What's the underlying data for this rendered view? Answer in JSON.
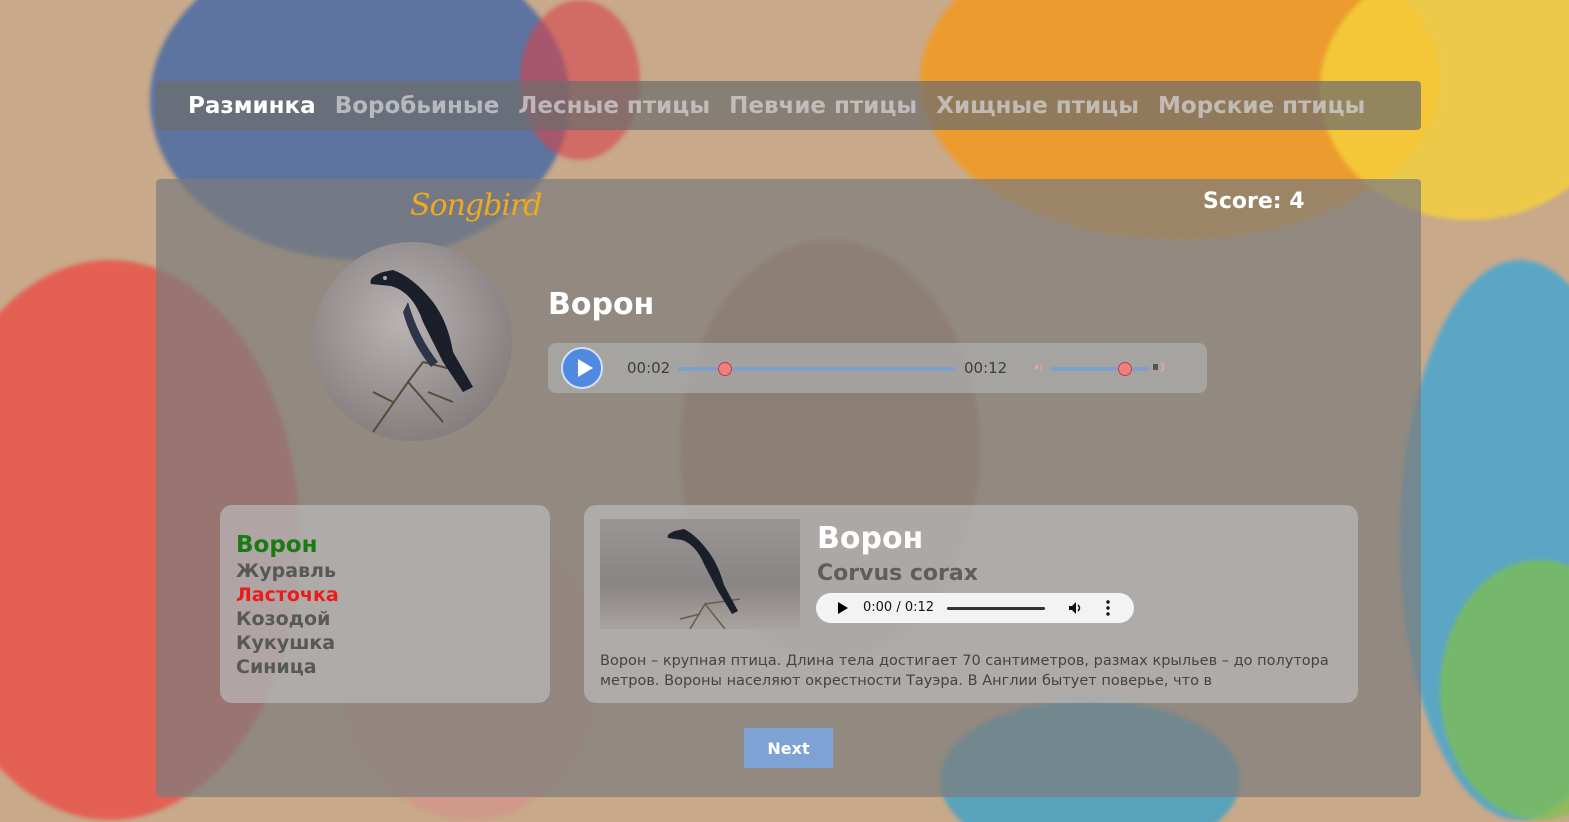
{
  "nav": {
    "items": [
      {
        "label": "Разминка",
        "active": true
      },
      {
        "label": "Воробьиные",
        "active": false
      },
      {
        "label": "Лесные птицы",
        "active": false
      },
      {
        "label": "Певчие птицы",
        "active": false
      },
      {
        "label": "Хищные птицы",
        "active": false
      },
      {
        "label": "Морские птицы",
        "active": false
      }
    ]
  },
  "header": {
    "logo": "Songbird",
    "score": "Score: 4"
  },
  "question": {
    "bird_name": "Ворон",
    "image_icon": "raven-photo",
    "player": {
      "current_time": "00:02",
      "duration": "00:12",
      "progress": 0.17,
      "volume": 0.75
    }
  },
  "options": [
    {
      "label": "Ворон",
      "state": "correct"
    },
    {
      "label": "Журавль",
      "state": "default"
    },
    {
      "label": "Ласточка",
      "state": "wrong"
    },
    {
      "label": "Козодой",
      "state": "default"
    },
    {
      "label": "Кукушка",
      "state": "default"
    },
    {
      "label": "Синица",
      "state": "default"
    }
  ],
  "details": {
    "name": "Ворон",
    "latin": "Corvus corax",
    "player_time": "0:00 / 0:12",
    "description": "Ворон – крупная птица. Длина тела достигает 70 сантиметров, размах крыльев – до полутора метров. Вороны населяют окрестности Тауэра. В Англии бытует поверье, что в"
  },
  "next_label": "Next",
  "colors": {
    "correct": "#1a7a14",
    "wrong": "#ee1a1a",
    "logo": "#f2a81d",
    "accent": "#7fa2d4"
  }
}
